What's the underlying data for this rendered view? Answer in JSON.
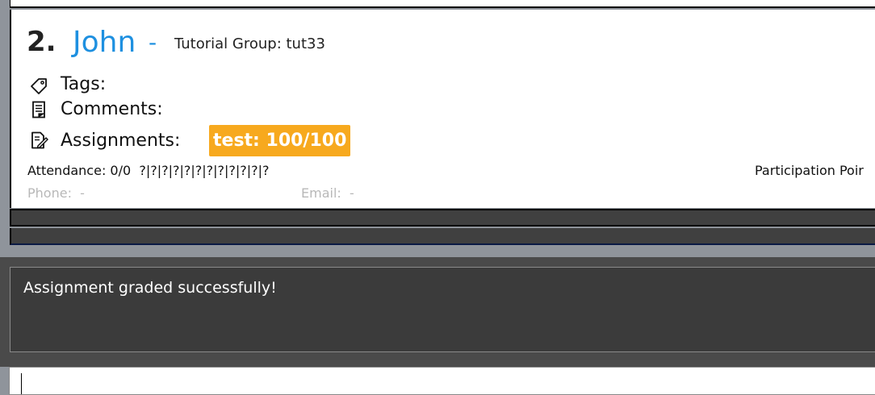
{
  "person": {
    "index": "2.",
    "name": "John",
    "separator": "-",
    "tutorial_group": "Tutorial Group: tut33",
    "tags_label": "Tags:",
    "comments_label": "Comments:",
    "assignments_label": "Assignments:",
    "assignment_badge": "test: 100/100",
    "attendance": "Attendance: 0/0  ?|?|?|?|?|?|?|?|?|?|?|?",
    "participation": "Participation Poir",
    "phone": "Phone:  -",
    "email": "Email:  -"
  },
  "result": {
    "message": "Assignment graded successfully!"
  },
  "command": {
    "value": ""
  },
  "colors": {
    "name": "#1e90e0",
    "badge": "#f7a91e",
    "result_bg": "#3b3b3b"
  },
  "icons": {
    "tags": "tag-icon",
    "comments": "notepad-icon",
    "assignments": "edit-document-icon"
  }
}
